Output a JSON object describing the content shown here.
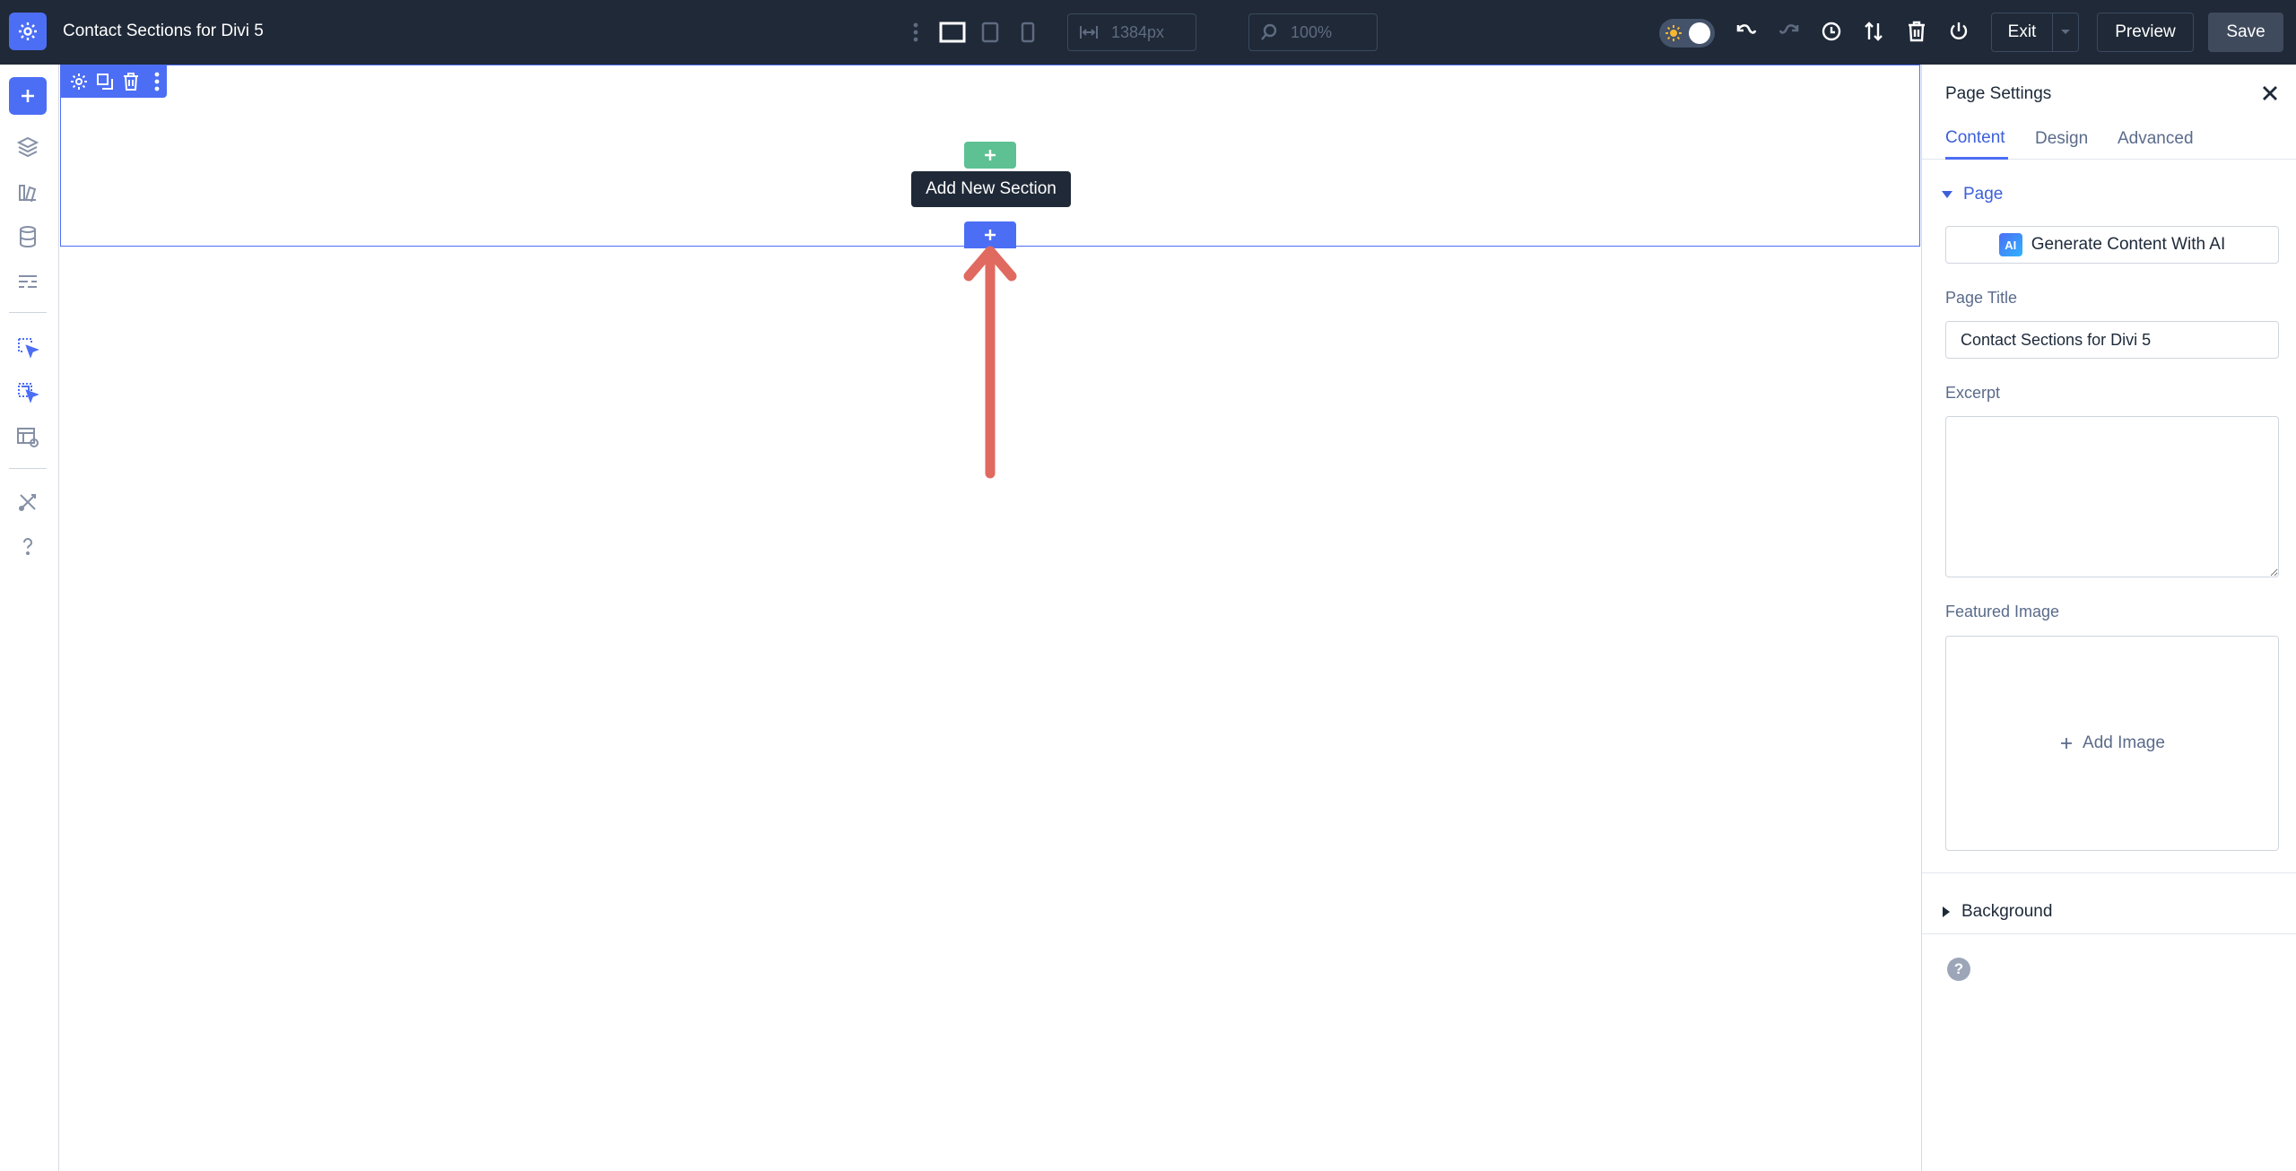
{
  "topbar": {
    "page_title": "Contact Sections for Divi 5",
    "width_value": "1384px",
    "zoom_value": "100%",
    "exit_label": "Exit",
    "preview_label": "Preview",
    "save_label": "Save"
  },
  "canvas": {
    "tooltip": "Add New Section"
  },
  "panel": {
    "title": "Page Settings",
    "tabs": [
      {
        "label": "Content",
        "active": true
      },
      {
        "label": "Design",
        "active": false
      },
      {
        "label": "Advanced",
        "active": false
      }
    ],
    "group_page": "Page",
    "ai_button": "Generate Content With AI",
    "ai_badge": "AI",
    "page_title_label": "Page Title",
    "page_title_value": "Contact Sections for Divi 5",
    "excerpt_label": "Excerpt",
    "excerpt_value": "",
    "featured_image_label": "Featured Image",
    "add_image_label": "Add Image",
    "group_background": "Background",
    "help_glyph": "?"
  },
  "colors": {
    "accent": "#4c6ef5",
    "topbar_bg": "#1f2937",
    "add_row": "#5dc193",
    "arrow": "#e06a5f"
  }
}
